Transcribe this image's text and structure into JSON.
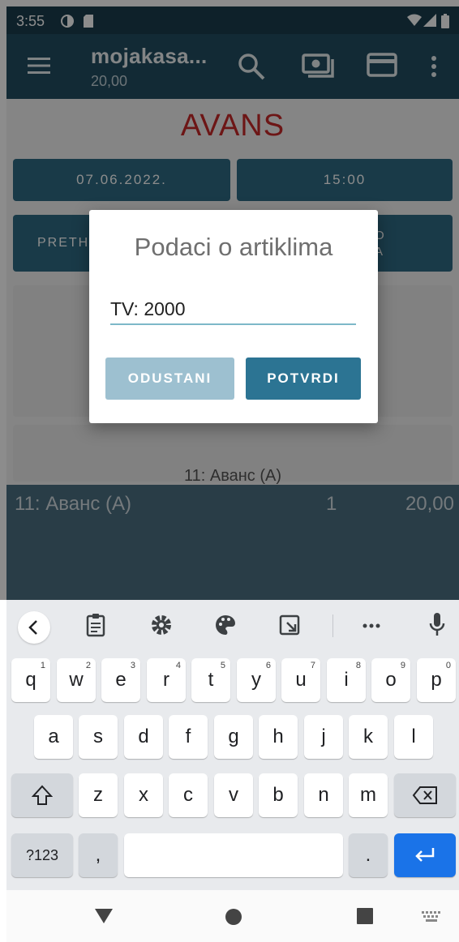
{
  "status_bar": {
    "time": "3:55"
  },
  "app_bar": {
    "title": "mojakasa...",
    "subtitle": "20,00"
  },
  "main": {
    "heading": "AVANS",
    "date": "07.06.2022.",
    "time": "15:00",
    "left_button_partial": "PRETH",
    "right_button_partial_1": "O",
    "right_button_partial_2": "A",
    "item_partial": "11: Аванс (А)"
  },
  "bottom_list": {
    "item_name": "11: Аванс (А)",
    "quantity": "1",
    "price": "20,00"
  },
  "dialog": {
    "title": "Podaci o artiklima",
    "input_value": "TV: 2000",
    "cancel_label": "ODUSTANI",
    "confirm_label": "POTVRDI"
  },
  "keyboard": {
    "row1": [
      {
        "k": "q",
        "n": "1"
      },
      {
        "k": "w",
        "n": "2"
      },
      {
        "k": "e",
        "n": "3"
      },
      {
        "k": "r",
        "n": "4"
      },
      {
        "k": "t",
        "n": "5"
      },
      {
        "k": "y",
        "n": "6"
      },
      {
        "k": "u",
        "n": "7"
      },
      {
        "k": "i",
        "n": "8"
      },
      {
        "k": "o",
        "n": "9"
      },
      {
        "k": "p",
        "n": "0"
      }
    ],
    "row2": [
      "a",
      "s",
      "d",
      "f",
      "g",
      "h",
      "j",
      "k",
      "l"
    ],
    "row3": [
      "z",
      "x",
      "c",
      "v",
      "b",
      "n",
      "m"
    ],
    "symbols_label": "?123",
    "comma": ",",
    "period": "."
  },
  "colors": {
    "app_bar": "#214e61",
    "accent_red": "#c62828",
    "confirm_button": "#2c7493",
    "cancel_button": "#9dc0d0",
    "enter_key": "#1a73e8"
  },
  "icons": [
    "menu-icon",
    "search-icon",
    "cash-icon",
    "credit-card-icon",
    "more-vert-icon",
    "keyboard-back-icon",
    "clipboard-icon",
    "settings-icon",
    "palette-icon",
    "resize-icon",
    "ellipsis-icon",
    "microphone-icon",
    "shift-icon",
    "backspace-icon",
    "enter-icon",
    "nav-back-icon",
    "nav-home-icon",
    "nav-recents-icon",
    "keyboard-switch-icon"
  ]
}
